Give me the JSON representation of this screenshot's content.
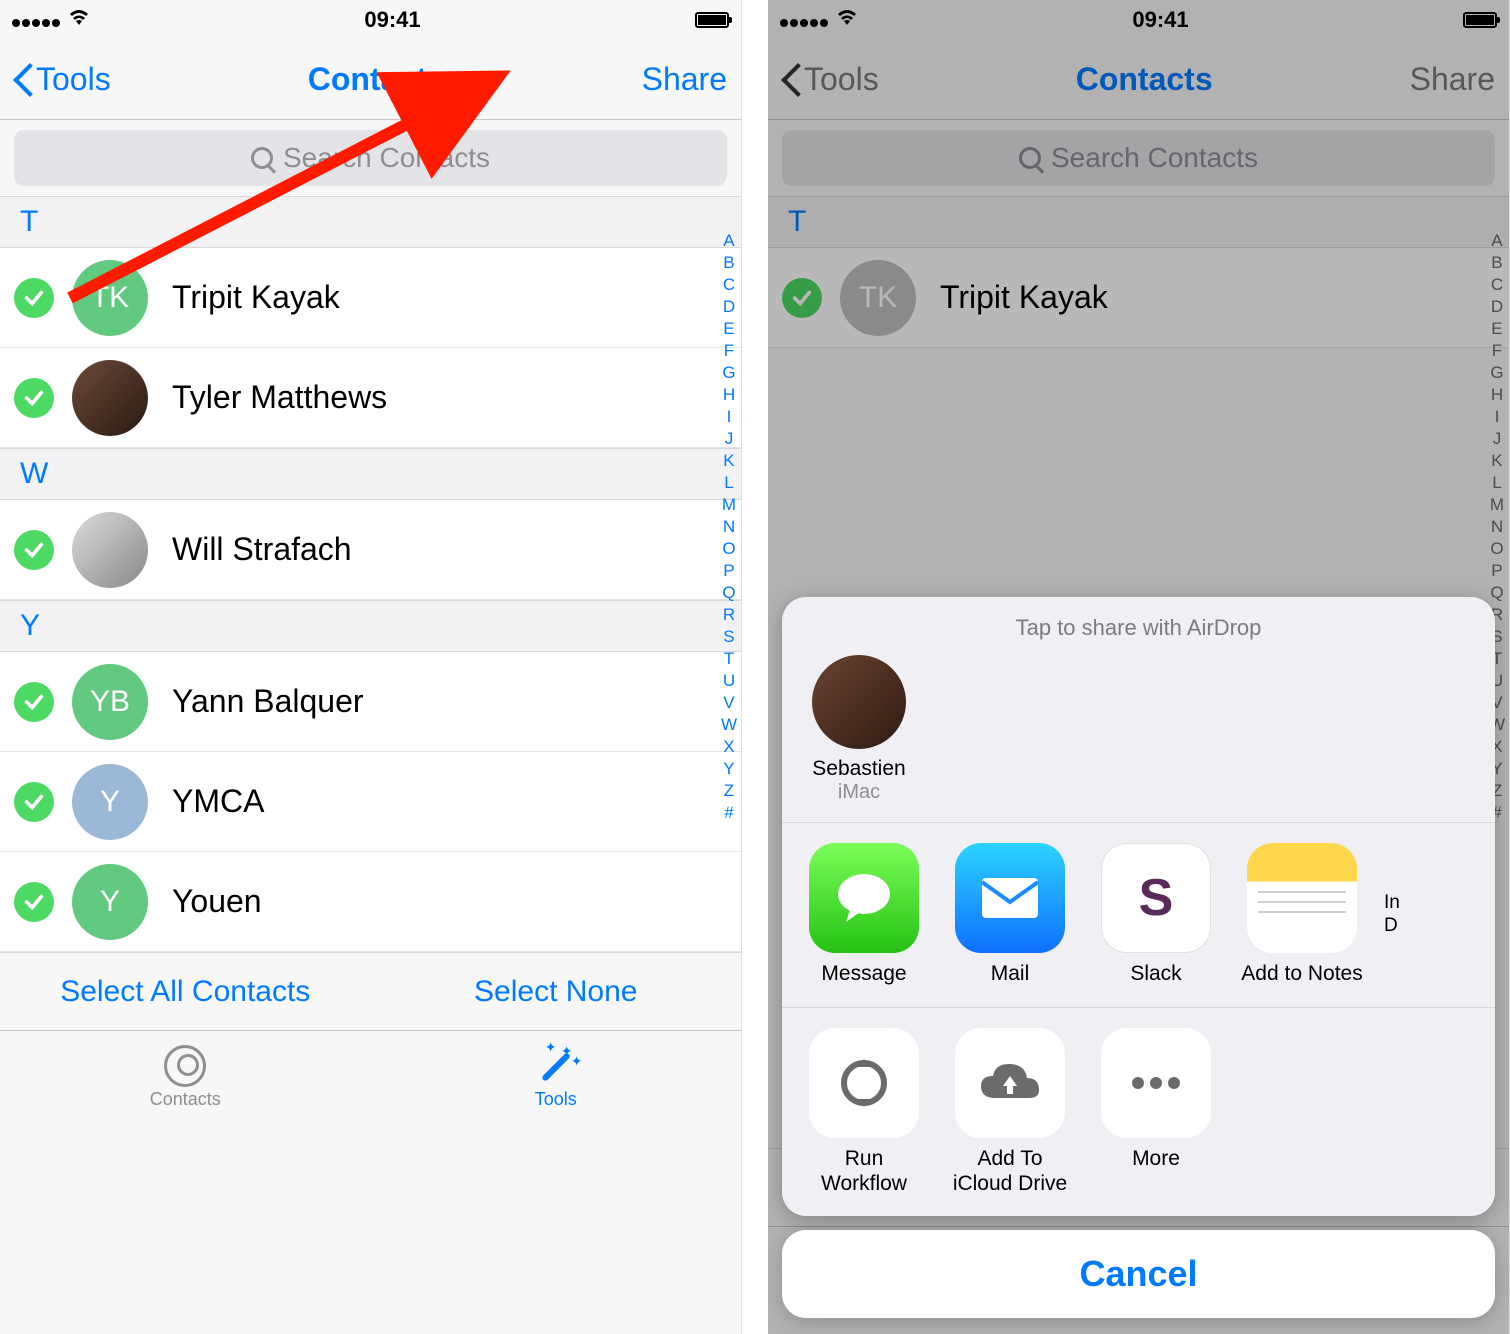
{
  "status": {
    "time": "09:41"
  },
  "nav": {
    "back": "Tools",
    "title": "Contacts",
    "share": "Share"
  },
  "search": {
    "placeholder": "Search Contacts"
  },
  "index_letters": [
    "A",
    "B",
    "C",
    "D",
    "E",
    "F",
    "G",
    "H",
    "I",
    "J",
    "K",
    "L",
    "M",
    "N",
    "O",
    "P",
    "Q",
    "R",
    "S",
    "T",
    "U",
    "V",
    "W",
    "X",
    "Y",
    "Z",
    "#"
  ],
  "sections": {
    "T": {
      "label": "T"
    },
    "W": {
      "label": "W"
    },
    "Y": {
      "label": "Y"
    }
  },
  "contacts": {
    "tk": {
      "name": "Tripit Kayak",
      "initials": "TK"
    },
    "tyler": {
      "name": "Tyler Matthews"
    },
    "will": {
      "name": "Will Strafach"
    },
    "yann": {
      "name": "Yann Balquer",
      "initials": "YB"
    },
    "ymca": {
      "name": "YMCA",
      "initials": "Y"
    },
    "youen": {
      "name": "Youen",
      "initials": "Y"
    }
  },
  "bottom": {
    "select_all": "Select All Contacts",
    "select_none": "Select None"
  },
  "tabs": {
    "contacts": "Contacts",
    "tools": "Tools"
  },
  "sheet": {
    "airdrop_hint": "Tap to share with AirDrop",
    "airdrop_name": "Sebastien",
    "airdrop_device": "iMac",
    "apps": {
      "message": "Message",
      "mail": "Mail",
      "slack": "Slack",
      "notes": "Add to Notes",
      "partial1": "In",
      "partial2": "D"
    },
    "actions": {
      "workflow": "Run\nWorkflow",
      "icloud": "Add To\niCloud Drive",
      "more": "More"
    },
    "cancel": "Cancel"
  }
}
